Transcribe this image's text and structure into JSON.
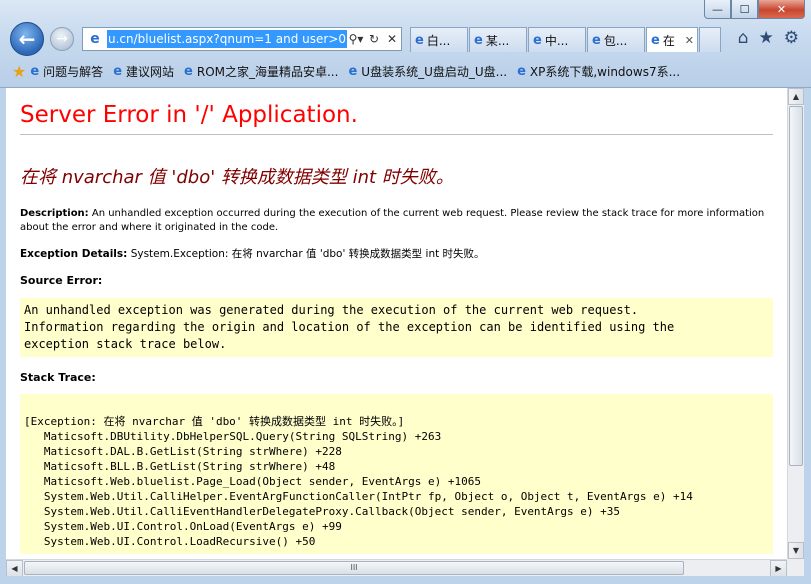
{
  "window": {
    "controls": {
      "minimize": "—",
      "maximize": "☐",
      "close": "✕"
    }
  },
  "nav": {
    "back_icon": "←",
    "forward_icon": "→",
    "address": "u.cn/bluelist.aspx?qnum=1 and user>0",
    "address_actions": [
      "⚲▾",
      "↻",
      "✕"
    ]
  },
  "tabs": [
    {
      "label": "白..."
    },
    {
      "label": "某..."
    },
    {
      "label": "中..."
    },
    {
      "label": "包..."
    },
    {
      "label": "在"
    }
  ],
  "toolbar_right": [
    "⌂",
    "★",
    "⚙"
  ],
  "favorites": [
    {
      "label": "问题与解答"
    },
    {
      "label": "建议网站"
    },
    {
      "label": "ROM之家_海量精品安卓..."
    },
    {
      "label": "U盘装系统_U盘启动_U盘..."
    },
    {
      "label": "XP系统下载,windows7系..."
    }
  ],
  "page": {
    "title": "Server Error in '/' Application.",
    "subtitle": "在将 nvarchar 值 'dbo' 转换成数据类型 int 时失败。",
    "description_label": "Description:",
    "description_text": " An unhandled exception occurred during the execution of the current web request. Please review the stack trace for more information about the error and where it originated in the code.",
    "exception_label": "Exception Details:",
    "exception_text": " System.Exception: 在将 nvarchar 值 'dbo' 转换成数据类型 int 时失败。",
    "source_error_label": "Source Error:",
    "source_error_text": "An unhandled exception was generated during the execution of the current web request.\nInformation regarding the origin and location of the exception can be identified using the\nexception stack trace below.",
    "stack_trace_label": "Stack Trace:",
    "stack_trace_text": "[Exception: 在将 nvarchar 值 'dbo' 转换成数据类型 int 时失败。]\n   Maticsoft.DBUtility.DbHelperSQL.Query(String SQLString) +263\n   Maticsoft.DAL.B.GetList(String strWhere) +228\n   Maticsoft.BLL.B.GetList(String strWhere) +48\n   Maticsoft.Web.bluelist.Page_Load(Object sender, EventArgs e) +1065\n   System.Web.Util.CalliHelper.EventArgFunctionCaller(IntPtr fp, Object o, Object t, EventArgs e) +14\n   System.Web.Util.CalliEventHandlerDelegateProxy.Callback(Object sender, EventArgs e) +35\n   System.Web.UI.Control.OnLoad(EventArgs e) +99\n   System.Web.UI.Control.LoadRecursive() +50"
  },
  "scroll": {
    "thumb_grip": "III"
  }
}
